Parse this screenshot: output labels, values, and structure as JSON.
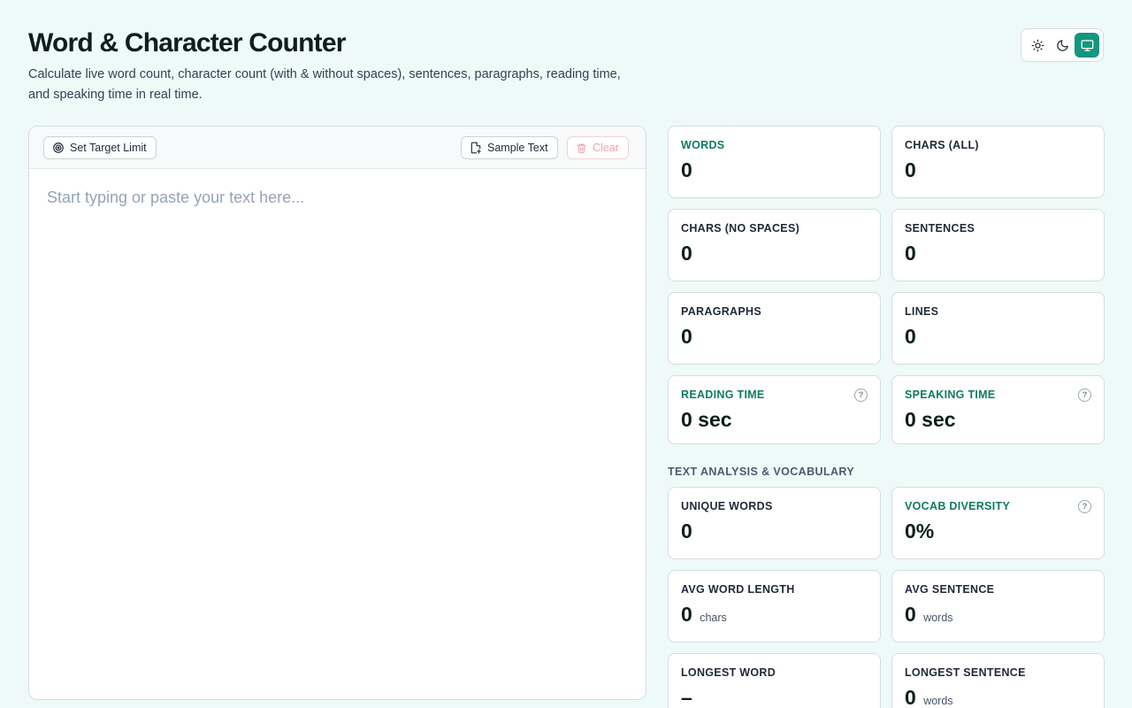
{
  "header": {
    "title": "Word & Character Counter",
    "subtitle": "Calculate live word count, character count (with & without spaces), sentences, paragraphs, reading time, and speaking time in real time."
  },
  "theme": {
    "options": [
      {
        "name": "light",
        "icon": "sun-icon"
      },
      {
        "name": "dark",
        "icon": "moon-icon"
      },
      {
        "name": "system",
        "icon": "monitor-icon",
        "active": true
      }
    ],
    "accent": "#14967f"
  },
  "editor": {
    "target_label": "Set Target Limit",
    "sample_label": "Sample Text",
    "clear_label": "Clear",
    "placeholder": "Start typing or paste your text here...",
    "value": ""
  },
  "stats": {
    "words": {
      "label": "WORDS",
      "value": "0"
    },
    "chars_all": {
      "label": "CHARS (ALL)",
      "value": "0"
    },
    "chars_no_spaces": {
      "label": "CHARS (NO SPACES)",
      "value": "0"
    },
    "sentences": {
      "label": "SENTENCES",
      "value": "0"
    },
    "paragraphs": {
      "label": "PARAGRAPHS",
      "value": "0"
    },
    "lines": {
      "label": "LINES",
      "value": "0"
    },
    "reading_time": {
      "label": "READING TIME",
      "value": "0 sec",
      "help": "?"
    },
    "speaking_time": {
      "label": "SPEAKING TIME",
      "value": "0 sec",
      "help": "?"
    }
  },
  "analysis": {
    "section_label": "TEXT ANALYSIS & VOCABULARY",
    "unique_words": {
      "label": "UNIQUE WORDS",
      "value": "0"
    },
    "vocab_diversity": {
      "label": "VOCAB DIVERSITY",
      "value": "0%",
      "help": "?"
    },
    "avg_word_length": {
      "label": "AVG WORD LENGTH",
      "value": "0",
      "unit": "chars"
    },
    "avg_sentence": {
      "label": "AVG SENTENCE",
      "value": "0",
      "unit": "words"
    },
    "longest_word": {
      "label": "LONGEST WORD",
      "value": "–"
    },
    "longest_sentence": {
      "label": "LONGEST SENTENCE",
      "value": "0",
      "unit": "words"
    }
  }
}
